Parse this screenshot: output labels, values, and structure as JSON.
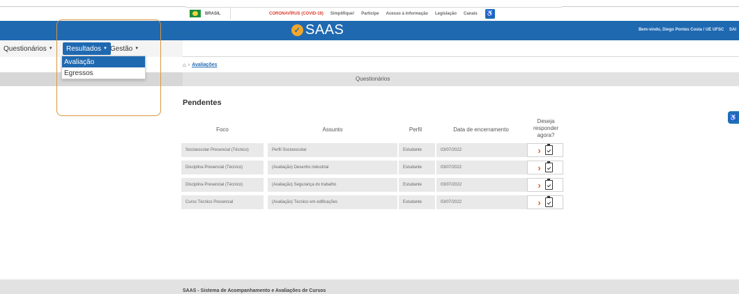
{
  "gov_bar": {
    "country": "BRASIL",
    "links": [
      "CORONAVÍRUS (COVID-19)",
      "Simplifique!",
      "Participe",
      "Acesso à informação",
      "Legislação",
      "Canais"
    ]
  },
  "header": {
    "logo_text": "SAAS",
    "welcome": "Bem-vindo, Diego Pontes Costa / UE UFSC",
    "welcome_suffix": "SAI"
  },
  "menu": {
    "questionarios": "Questionários",
    "resultados": "Resultados",
    "gestao": "Gestão",
    "dropdown": [
      "Avaliação",
      "Egressos"
    ]
  },
  "breadcrumb": {
    "current": "Avaliações"
  },
  "section": {
    "title": "Questionários"
  },
  "pendentes": {
    "title": "Pendentes",
    "columns": {
      "foco": "Foco",
      "assunto": "Assunto",
      "perfil": "Perfil",
      "data": "Data de encerramento",
      "deseja": "Deseja responder agora?"
    },
    "rows": [
      {
        "foco": "Socioescolar Presencial (Técnico)",
        "assunto": "Perfil Socioescolar",
        "perfil": "Estudante",
        "data": "03/07/2022"
      },
      {
        "foco": "Disciplina Presencial (Técnico)",
        "assunto": "(Avaliação) Desenho industrial",
        "perfil": "Estudante",
        "data": "03/07/2022"
      },
      {
        "foco": "Disciplina Presencial (Técnico)",
        "assunto": "(Avaliação) Segurança do trabalho",
        "perfil": "Estudante",
        "data": "03/07/2022"
      },
      {
        "foco": "Curso Técnico Presencial",
        "assunto": "(Avaliação) Técnico em edificações",
        "perfil": "Estudante",
        "data": "03/07/2022"
      }
    ]
  },
  "footer": {
    "text": "SAAS - Sistema de Acompanhamento e Avaliações de Cursos"
  },
  "icons": {
    "accessibility": "accessibility-icon",
    "respond": "chevron-right-icon",
    "questionnaire": "clipboard-icon"
  },
  "colors": {
    "brand_blue": "#1f69b1",
    "accent_orange": "#e2631f",
    "highlight": "#d9963a"
  }
}
